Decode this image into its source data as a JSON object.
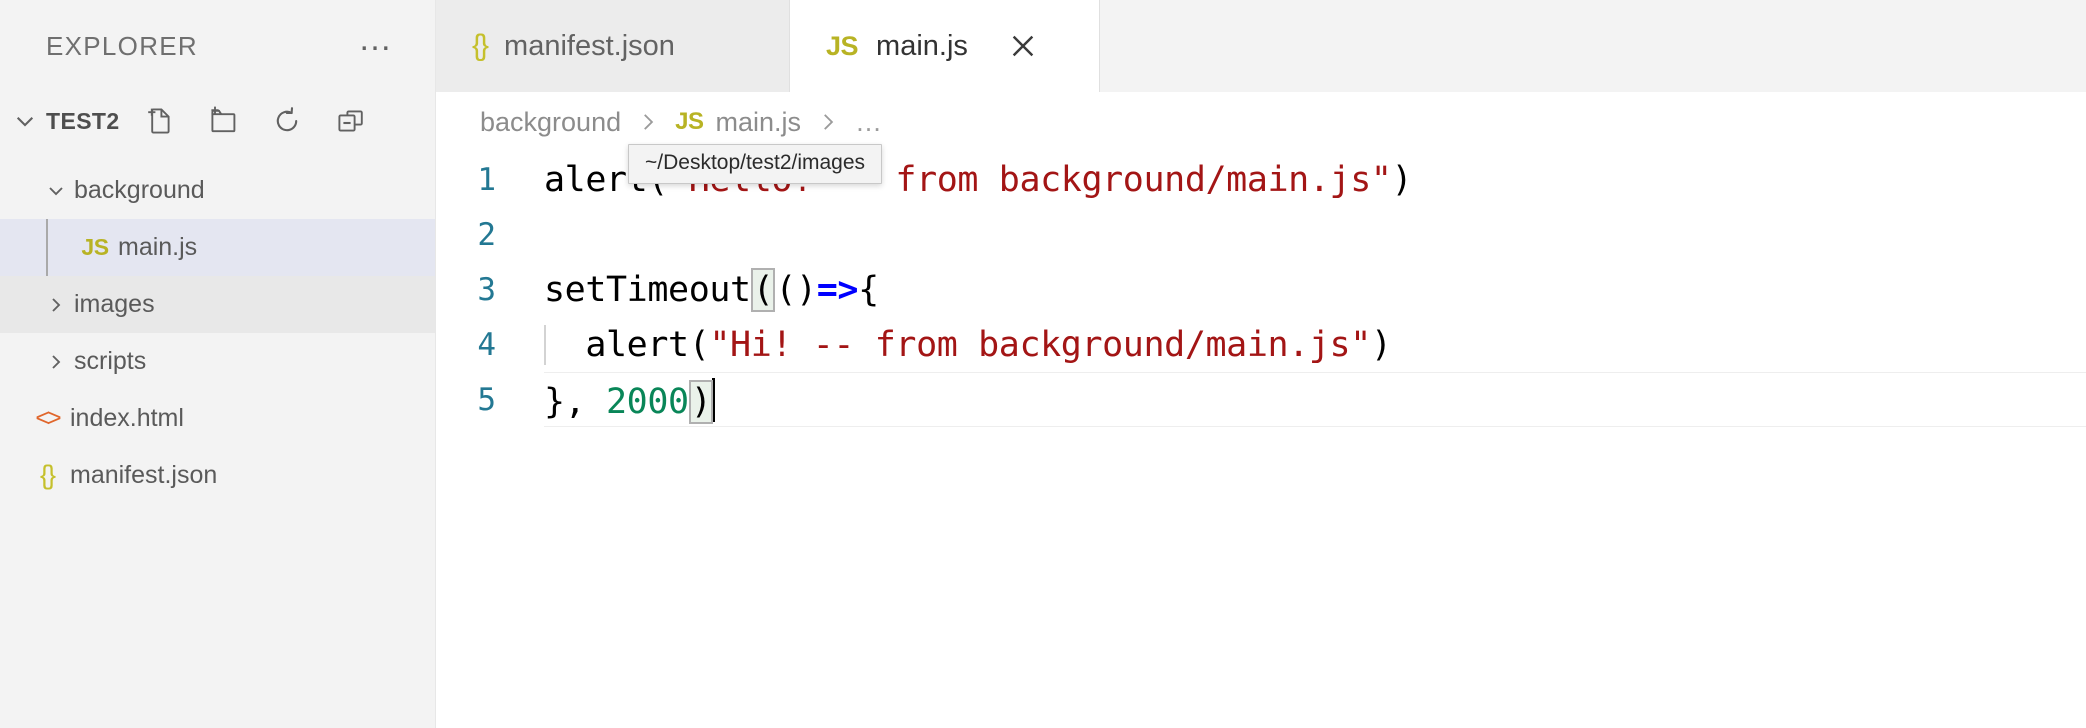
{
  "sidebar": {
    "title": "EXPLORER",
    "more_label": "…",
    "root": {
      "name": "TEST2",
      "actions": [
        {
          "name": "new-file",
          "label": "New File"
        },
        {
          "name": "new-folder",
          "label": "New Folder"
        },
        {
          "name": "refresh",
          "label": "Refresh Explorer"
        },
        {
          "name": "collapse",
          "label": "Collapse Folders in Explorer"
        }
      ]
    },
    "items": [
      {
        "label": "background",
        "type": "folder",
        "expanded": true,
        "level": 1,
        "state": "normal",
        "icon": "chevron-down-icon"
      },
      {
        "label": "main.js",
        "type": "file",
        "level": 2,
        "state": "selected",
        "icon": "js-icon",
        "icon_text": "JS"
      },
      {
        "label": "images",
        "type": "folder",
        "expanded": false,
        "level": 1,
        "state": "hover",
        "icon": "chevron-right-icon"
      },
      {
        "label": "scripts",
        "type": "folder",
        "expanded": false,
        "level": 1,
        "state": "normal",
        "icon": "chevron-right-icon"
      },
      {
        "label": "index.html",
        "type": "file",
        "level": 1,
        "state": "normal",
        "icon": "html-icon",
        "icon_text": "<>"
      },
      {
        "label": "manifest.json",
        "type": "file",
        "level": 1,
        "state": "normal",
        "icon": "json-icon",
        "icon_text": "{}"
      }
    ]
  },
  "tabs": [
    {
      "label": "manifest.json",
      "icon_text": "{}",
      "icon": "json-icon",
      "active": false,
      "closable": false
    },
    {
      "label": "main.js",
      "icon_text": "JS",
      "icon": "js-icon",
      "active": true,
      "closable": true,
      "close_label": "×"
    }
  ],
  "breadcrumb": {
    "items": [
      {
        "label": "background",
        "icon": null
      },
      {
        "label": "main.js",
        "icon": "js-icon",
        "icon_text": "JS"
      },
      {
        "label": "…",
        "icon": null
      }
    ],
    "separator": "›"
  },
  "editor": {
    "language": "javascript",
    "lines": [
      {
        "number": "1",
        "text": "alert(\"Hello! -- from background/main.js\")"
      },
      {
        "number": "2",
        "text": ""
      },
      {
        "number": "3",
        "text": "setTimeout(()=>{"
      },
      {
        "number": "4",
        "text": "  alert(\"Hi! -- from background/main.js\")"
      },
      {
        "number": "5",
        "text": "}, 2000)"
      }
    ],
    "tokens": {
      "l1_fn": "alert(",
      "l1_str": "\"Hello! -- from background/main.js\"",
      "l1_end": ")",
      "l3_fn": "setTimeout",
      "l3_openparen": "(",
      "l3_mid": "()",
      "l3_arrow": "=>",
      "l3_brace": "{",
      "l4_fn": "alert(",
      "l4_str": "\"Hi! -- from background/main.js\"",
      "l4_end": ")",
      "l5_pre": "}, ",
      "l5_num": "2000",
      "l5_end": ")"
    },
    "cursor_line": "5"
  },
  "tooltip": {
    "text": "~/Desktop/test2/images"
  },
  "colors": {
    "accent_line_number": "#237893",
    "string": "#A31515",
    "number": "#098658",
    "arrow": "#0000FF",
    "js_icon": "#B8B324",
    "json_icon": "#C5C02C",
    "html_icon": "#E0662B",
    "selection": "#E4E6F1",
    "hover": "#E8E8E8",
    "sidebar_bg": "#F3F3F3",
    "tab_inactive_bg": "#ECECEC",
    "editor_bg": "#FFFFFF"
  }
}
